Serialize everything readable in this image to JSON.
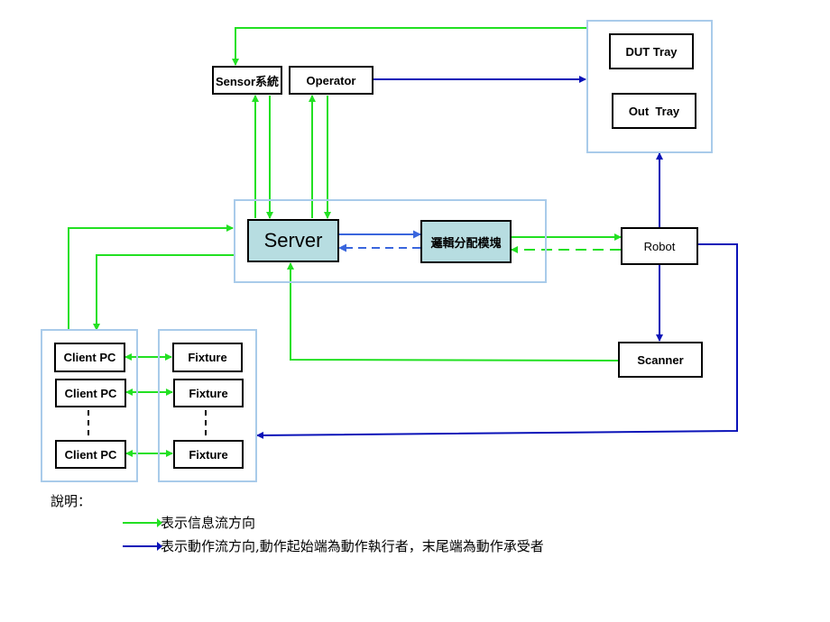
{
  "colors": {
    "info_flow": "#22e022",
    "action_flow": "#0a12b8",
    "internal_flow": "#3a66dd",
    "group_border": "#a9cbea",
    "teal_fill": "#b7dde1"
  },
  "nodes": {
    "sensor": "Sensor系統",
    "operator": "Operator",
    "dut_tray": "DUT Tray",
    "out_tray": "Out  Tray",
    "server": "Server",
    "logic_module": "邏輯分配模塊",
    "robot": "Robot",
    "scanner": "Scanner",
    "client_pcs": [
      "Client PC",
      "Client PC",
      "Client PC"
    ],
    "fixtures": [
      "Fixture",
      "Fixture",
      "Fixture"
    ]
  },
  "legend": {
    "title": "說明：",
    "items": [
      {
        "type": "info",
        "label": "表示信息流方向"
      },
      {
        "type": "action",
        "label": "表示動作流方向,動作起始端為動作執行者，末尾端為動作承受者"
      }
    ]
  }
}
